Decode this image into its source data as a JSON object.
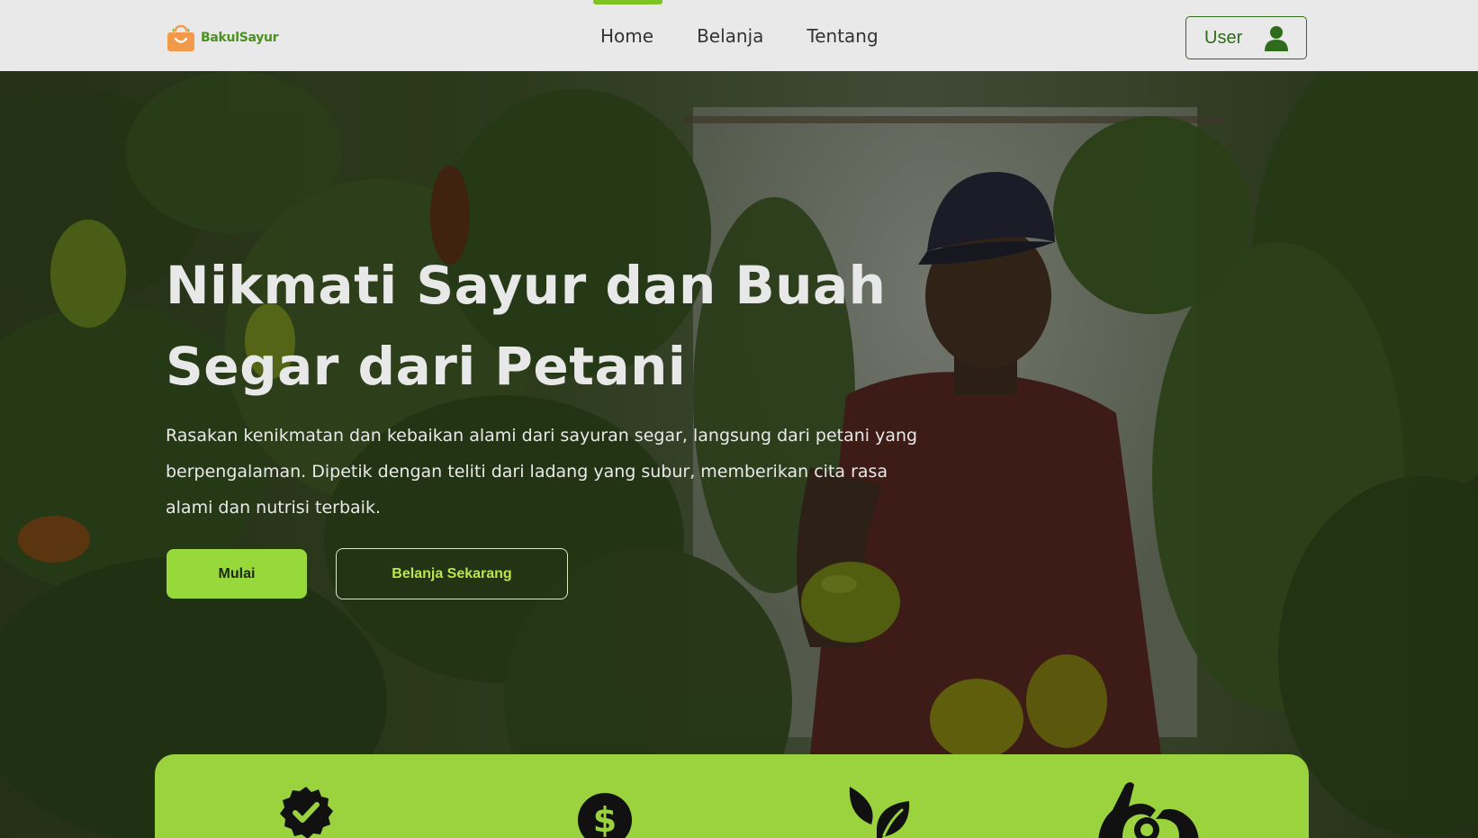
{
  "brand": {
    "name": "BakulSayur",
    "logo_icon": "shopping-bag-icon",
    "logo_color": "#f39a4a"
  },
  "nav": {
    "items": [
      {
        "label": "Home",
        "active": true
      },
      {
        "label": "Belanja",
        "active": false
      },
      {
        "label": "Tentang",
        "active": false
      }
    ],
    "active_indicator_color": "#7fc324"
  },
  "user_button": {
    "label": "User",
    "icon": "user-icon"
  },
  "hero": {
    "title_line1": "Nikmati Sayur dan Buah",
    "title_line2": "Segar dari Petani",
    "description": "Rasakan kenikmatan dan kebaikan alami dari sayuran segar, langsung dari petani yang berpengalaman. Dipetik dengan teliti dari ladang yang subur, memberikan cita rasa alami dan nutrisi terbaik.",
    "primary_button": "Mulai",
    "secondary_button": "Belanja Sekarang",
    "background_image": "farmer-holding-bell-peppers-in-greenhouse"
  },
  "features": {
    "icons": [
      "verified-badge-icon",
      "dollar-coin-icon",
      "leaf-sprout-icon",
      "hands-heart-icon"
    ],
    "bar_color": "#9bd33f"
  },
  "colors": {
    "accent": "#97d93a",
    "header_bg": "#e9e9e9",
    "brand_green": "#2e6b1a"
  }
}
